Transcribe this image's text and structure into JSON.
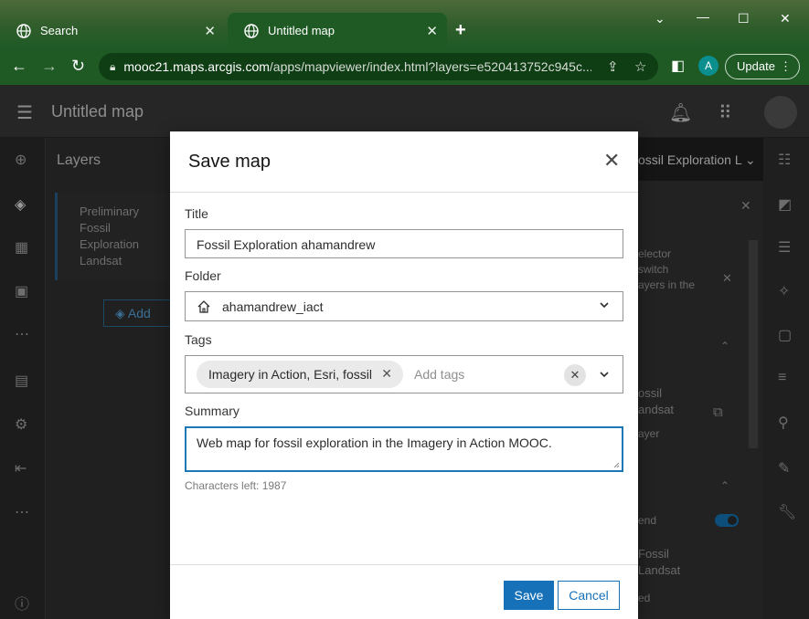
{
  "browser": {
    "tabs": [
      {
        "label": "Search"
      },
      {
        "label": "Untitled map"
      }
    ],
    "url_domain": "mooc21.maps.arcgis.com",
    "url_path": "/apps/mapviewer/index.html?layers=e520413752c945c...",
    "profile_initial": "A",
    "update_label": "Update"
  },
  "app": {
    "title": "Untitled map",
    "layers_heading": "Layers",
    "layer_item": "Preliminary Fossil Exploration Landsat",
    "add_label": "Add",
    "right_panel_title": "ossil Exploration L",
    "right_panel_texts": [
      "elector",
      "switch",
      "ayers in the",
      "ossil",
      "andsat",
      "ayer",
      "end",
      "Fossil",
      "Landsat",
      "ed"
    ]
  },
  "dialog": {
    "title": "Save map",
    "title_label": "Title",
    "title_value": "Fossil Exploration ahamandrew",
    "folder_label": "Folder",
    "folder_value": "ahamandrew_iact",
    "tags_label": "Tags",
    "tags_chip": "Imagery in Action, Esri, fossil",
    "tags_placeholder": "Add tags",
    "summary_label": "Summary",
    "summary_value": "Web map for fossil exploration in the Imagery in Action MOOC.",
    "chars_left": "Characters left: 1987",
    "save_label": "Save",
    "cancel_label": "Cancel"
  },
  "colors": {
    "accent": "#1771b8",
    "browser_green": "#1f5a25"
  }
}
